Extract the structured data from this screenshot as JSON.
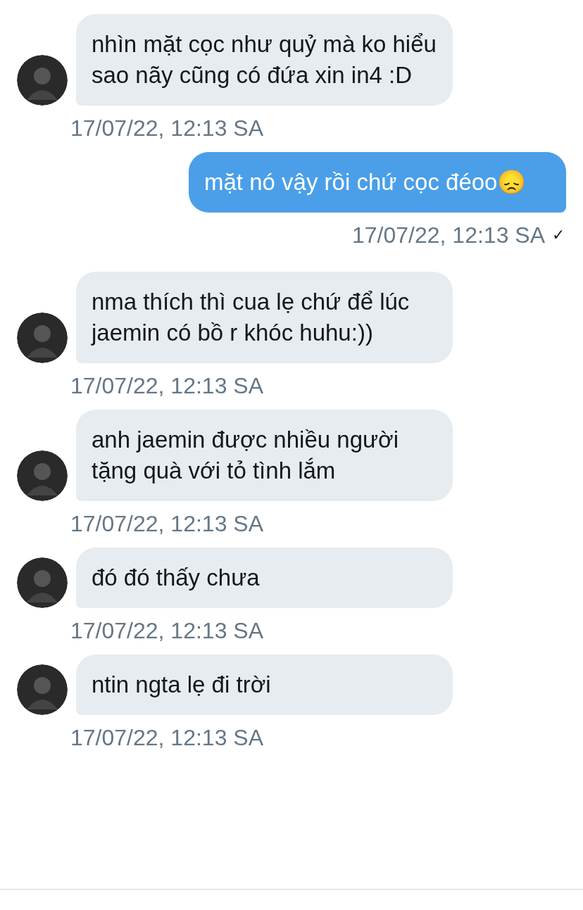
{
  "messages": [
    {
      "kind": "incoming",
      "text": "nhìn mặt cọc như quỷ mà ko hiểu sao nãy cũng có đứa xin in4 :D",
      "time": "17/07/22, 12:13 SA"
    },
    {
      "kind": "outgoing",
      "text": "mặt nó vậy rồi chứ cọc đéoo😞",
      "time": "17/07/22, 12:13 SA",
      "status": "✓"
    },
    {
      "kind": "incoming",
      "text": "nma thích thì cua lẹ chứ để lúc jaemin có bồ r khóc huhu:))",
      "time": "17/07/22, 12:13 SA"
    },
    {
      "kind": "incoming",
      "text": "anh jaemin được nhiều người tặng quà với tỏ tình lắm",
      "time": "17/07/22, 12:13 SA"
    },
    {
      "kind": "incoming",
      "text": "đó đó thấy chưa",
      "time": "17/07/22, 12:13 SA"
    },
    {
      "kind": "incoming",
      "text": "ntin ngta lẹ đi trời",
      "time": "17/07/22, 12:13 SA"
    }
  ]
}
